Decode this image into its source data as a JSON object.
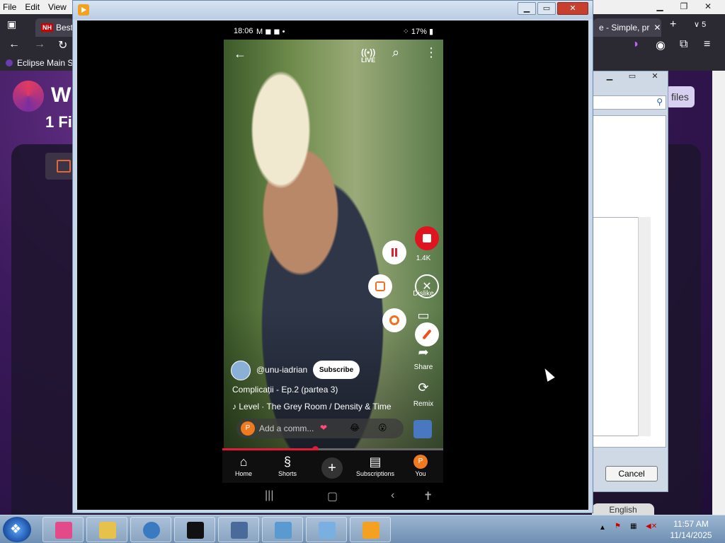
{
  "browser": {
    "menu": [
      "File",
      "Edit",
      "View"
    ],
    "tabs": [
      {
        "badge": "NH",
        "label": "Best"
      },
      {
        "label": "e - Simple, pr"
      }
    ],
    "tab_count": "5",
    "bookmark": "Eclipse Main S",
    "page_brand_letter": "W",
    "files_heading": "1 Fi",
    "files_button": "files",
    "language_button": "English"
  },
  "dialog": {
    "cancel_label": "Cancel"
  },
  "phone": {
    "status_time": "18:06",
    "status_icons": "M ◼ ◼ •",
    "status_right": "17%",
    "live_label": "LIVE",
    "like_count": "1.4K",
    "dislike_label": "Dislike",
    "share_label": "Share",
    "remix_label": "Remix",
    "channel_handle": "@unu-iadrian",
    "subscribe_label": "Subscribe",
    "video_title": "Complicații - Ep.2 (partea 3)",
    "music": "Level · The Grey Room / Density & Time",
    "comment_avatar": "P",
    "comment_placeholder": "Add a comm...",
    "emojis": [
      "❤",
      "😂",
      "😮"
    ],
    "progress_fraction": 0.42,
    "nav": [
      {
        "label": "Home",
        "icon": "home-icon"
      },
      {
        "label": "Shorts",
        "icon": "shorts-icon"
      },
      {
        "label": "Subscriptions",
        "icon": "subscriptions-icon"
      },
      {
        "label": "You",
        "icon": "profile-avatar"
      }
    ],
    "you_avatar": "P"
  },
  "taskbar": {
    "time": "11:57 AM",
    "date": "11/14/2025"
  },
  "colors": {
    "accent_red": "#e21c38",
    "record_orange": "#f07020",
    "tab_dark": "#2b2a33"
  }
}
